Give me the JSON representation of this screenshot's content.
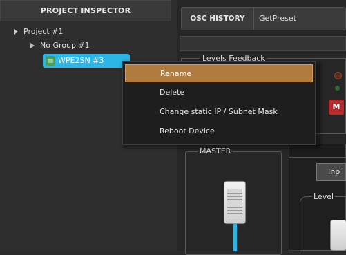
{
  "inspector": {
    "title": "PROJECT INSPECTOR",
    "project": "Project #1",
    "group": "No Group #1",
    "device": "WPE2SN #3"
  },
  "osc": {
    "label": "OSC HISTORY",
    "value": "GetPreset"
  },
  "levels_feedback": {
    "title": "Levels Feedback"
  },
  "mute_label": "M",
  "master": {
    "title": "MASTER",
    "fader_level": 0.62
  },
  "input_tab": {
    "label": "Inp"
  },
  "levels2": {
    "title": "Level"
  },
  "context_menu": {
    "items": [
      {
        "label": "Rename",
        "highlighted": true
      },
      {
        "label": "Delete",
        "highlighted": false
      },
      {
        "label": "Change static IP / Subnet Mask",
        "highlighted": false
      },
      {
        "label": "Reboot Device",
        "highlighted": false
      }
    ]
  },
  "colors": {
    "selection": "#2bb6e6",
    "menu_highlight": "#b07b3e",
    "mute": "#b52a2a",
    "fader_fill": "#29b6e6"
  }
}
